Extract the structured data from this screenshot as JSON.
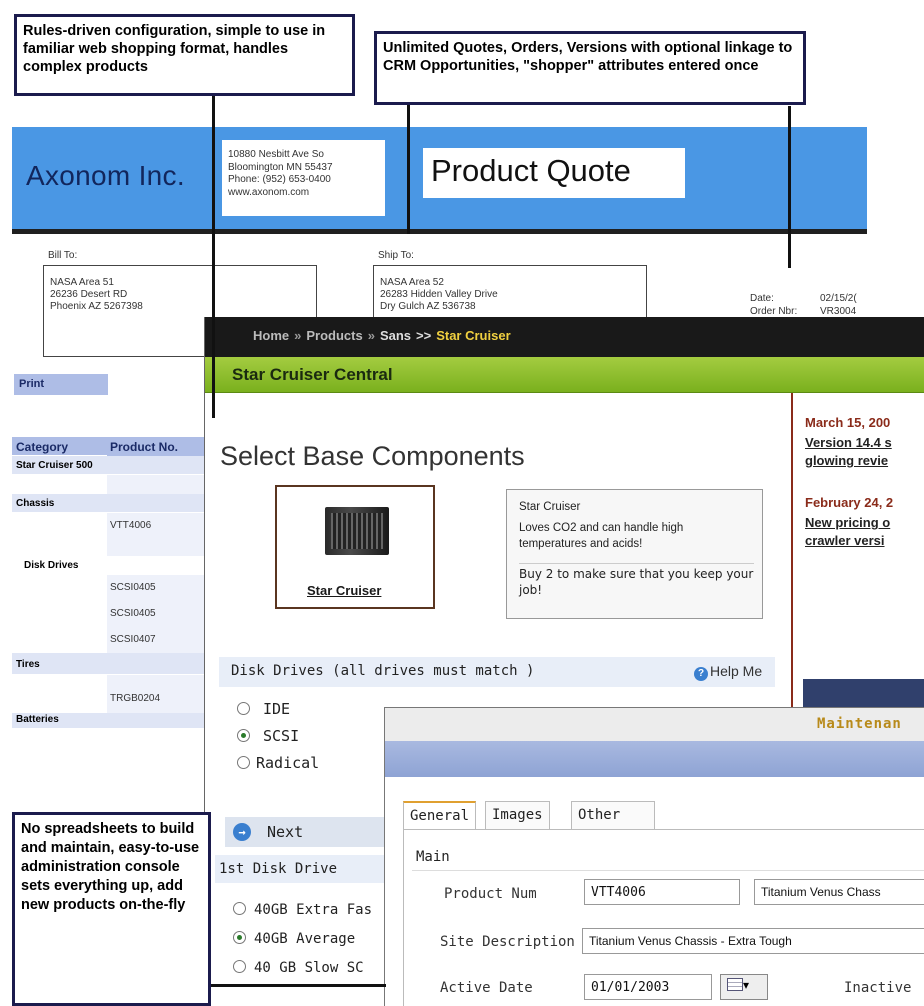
{
  "callouts": {
    "config": "Rules-driven configuration, simple to use in familiar web shopping format, handles complex products",
    "quotes": "Unlimited Quotes, Orders, Versions with optional linkage to CRM Opportunities, \"shopper\" attributes entered once",
    "admin": "No spreadsheets to build and maintain, easy-to-use administration console sets everything up, add new products on-the-fly"
  },
  "quote": {
    "company": "Axonom Inc.",
    "address_lines": [
      "10880 Nesbitt Ave So",
      "Bloomington MN  55437",
      "Phone: (952) 653-0400",
      "www.axonom.com"
    ],
    "title": "Product Quote",
    "bill_to_label": "Bill To:",
    "bill_to_lines": [
      "NASA Area 51",
      "26236 Desert RD",
      "Phoenix    AZ 5267398"
    ],
    "ship_to_label": "Ship To:",
    "ship_to_lines": [
      "NASA Area 52",
      "26283 Hidden Valley Drive",
      "Dry Gulch  AZ  536738"
    ],
    "date_label": "Date:",
    "date_value": "02/15/2(",
    "order_label": "Order Nbr:",
    "order_value": "VR3004",
    "print_label": "Print",
    "table": {
      "headers": [
        "Category",
        "Product No."
      ],
      "rows": [
        {
          "type": "group",
          "category": "Star Cruiser 500",
          "product": ""
        },
        {
          "type": "group",
          "category": "Chassis",
          "product": ""
        },
        {
          "type": "item",
          "category": "",
          "product": "VTT4006"
        },
        {
          "type": "group",
          "category": "Disk Drives",
          "product": ""
        },
        {
          "type": "item",
          "category": "",
          "product": "SCSI0405"
        },
        {
          "type": "item",
          "category": "",
          "product": "SCSI0405"
        },
        {
          "type": "item",
          "category": "",
          "product": "SCSI0407"
        },
        {
          "type": "group",
          "category": "Tires",
          "product": ""
        },
        {
          "type": "item",
          "category": "",
          "product": "TRGB0204"
        },
        {
          "type": "group",
          "category": "Batteries",
          "product": ""
        }
      ]
    }
  },
  "shop": {
    "breadcrumb": [
      "Home",
      "Products",
      "Sans"
    ],
    "breadcrumb_seps": [
      "»",
      "»",
      ">>"
    ],
    "breadcrumb_active": "Star Cruiser",
    "section_title": "Star Cruiser Central",
    "page_title": "Select Base Components",
    "product_link": "Star Cruiser",
    "promo": {
      "name": "Star Cruiser",
      "tagline": "Loves CO2 and can handle high temperatures and acids!",
      "note": "Buy 2 to make sure that you keep your job!"
    },
    "news": [
      {
        "date": "March 15, 200",
        "links": [
          "Version 14.4 s",
          "glowing revie"
        ]
      },
      {
        "date": "February 24, 2",
        "links": [
          "New pricing o",
          "crawler versi"
        ]
      }
    ],
    "disk_header": "Disk Drives (all drives must match )",
    "help_label": "Help Me",
    "help_icon": "?",
    "disk_options": [
      {
        "label": "IDE",
        "selected": false
      },
      {
        "label": "SCSI",
        "selected": true
      },
      {
        "label": "Radical",
        "selected": false
      }
    ],
    "next_label": "Next",
    "next_icon": "→",
    "first_disk_label": "1st Disk Drive",
    "first_disk_options": [
      {
        "label": "40GB Extra Fas",
        "selected": false
      },
      {
        "label": "40GB Average",
        "selected": true
      },
      {
        "label": "40 GB Slow SC",
        "selected": false
      }
    ]
  },
  "maint": {
    "title": "Maintenan",
    "tabs": [
      "General",
      "Images",
      "Other"
    ],
    "section": "Main",
    "product_num_label": "Product Num",
    "product_num_value": "VTT4006",
    "product_name_value": "Titanium Venus Chass",
    "site_desc_label": "Site Description",
    "site_desc_value": "Titanium Venus Chassis - Extra Tough",
    "active_date_label": "Active Date",
    "active_date_value": "01/01/2003",
    "inactive_label": "Inactive",
    "dropdown_arrow": "▾"
  }
}
